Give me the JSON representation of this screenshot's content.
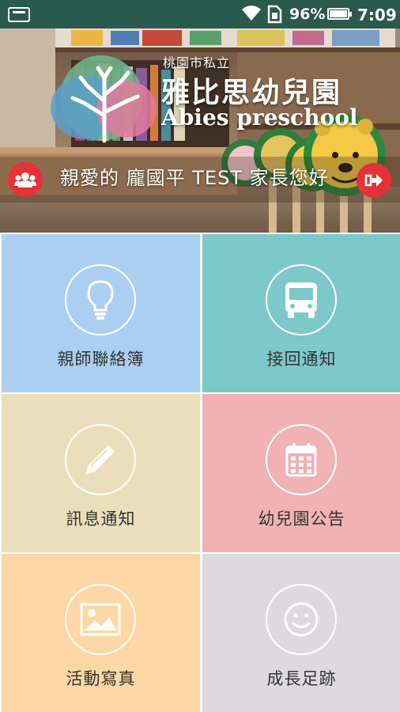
{
  "status_bar": {
    "battery_percent": "96%",
    "time": "7:09"
  },
  "header": {
    "school_subtitle": "桃園市私立",
    "school_name_zh": "雅比思幼兒園",
    "school_name_en": "Abies preschool",
    "welcome_text": "親愛的 龐國平 TEST 家長您好"
  },
  "menu": {
    "items": [
      {
        "label": "親師聯絡簿",
        "icon": "lightbulb-icon",
        "color": "#abcff0"
      },
      {
        "label": "接回通知",
        "icon": "bus-icon",
        "color": "#7cc8cb"
      },
      {
        "label": "訊息通知",
        "icon": "pencil-icon",
        "color": "#eadfba"
      },
      {
        "label": "幼兒園公告",
        "icon": "calendar-icon",
        "color": "#f1b2b4"
      },
      {
        "label": "活動寫真",
        "icon": "image-icon",
        "color": "#fdd8a4"
      },
      {
        "label": "成長足跡",
        "icon": "smiley-icon",
        "color": "#dcdadd"
      }
    ]
  },
  "colors": {
    "status_bar": "#2a5a4c",
    "accent_red": "#e53239"
  }
}
